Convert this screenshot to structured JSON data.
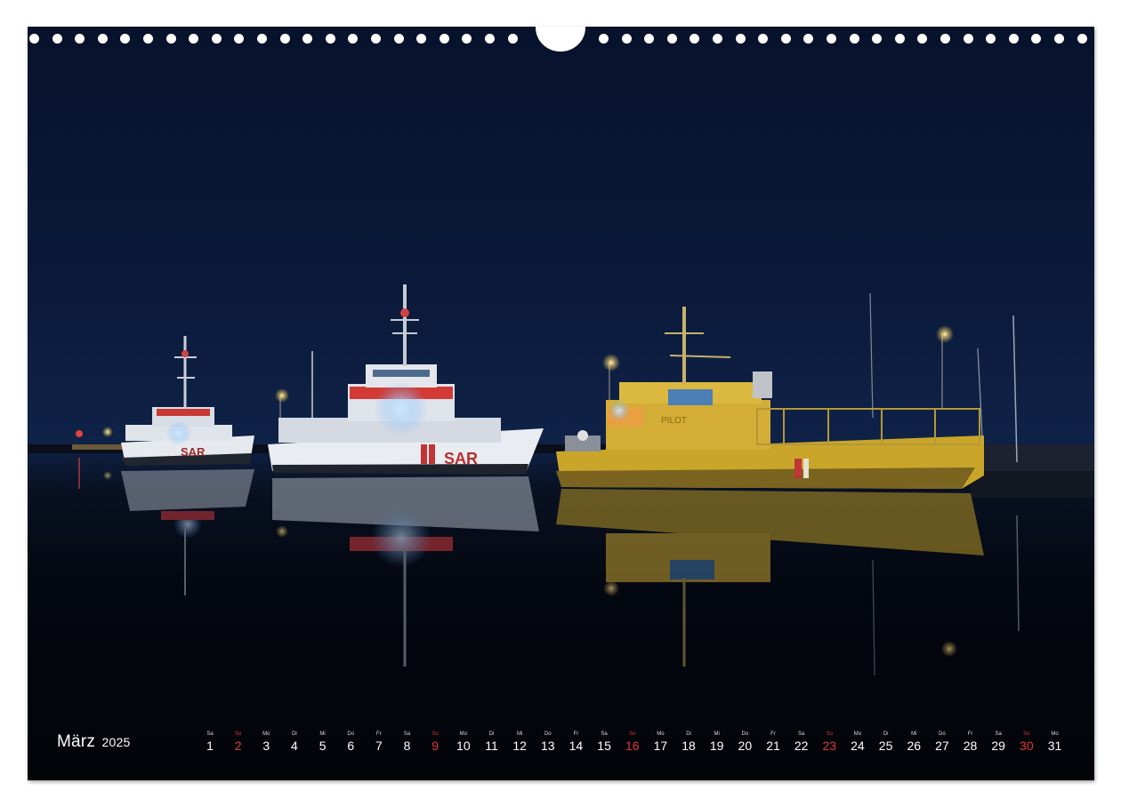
{
  "calendar": {
    "month": "März",
    "year": "2025",
    "days": [
      {
        "weekday": "Sa",
        "day": "1",
        "sunday": false
      },
      {
        "weekday": "So",
        "day": "2",
        "sunday": true
      },
      {
        "weekday": "Mo",
        "day": "3",
        "sunday": false
      },
      {
        "weekday": "Di",
        "day": "4",
        "sunday": false
      },
      {
        "weekday": "Mi",
        "day": "5",
        "sunday": false
      },
      {
        "weekday": "Do",
        "day": "6",
        "sunday": false
      },
      {
        "weekday": "Fr",
        "day": "7",
        "sunday": false
      },
      {
        "weekday": "Sa",
        "day": "8",
        "sunday": false
      },
      {
        "weekday": "So",
        "day": "9",
        "sunday": true
      },
      {
        "weekday": "Mo",
        "day": "10",
        "sunday": false
      },
      {
        "weekday": "Di",
        "day": "11",
        "sunday": false
      },
      {
        "weekday": "Mi",
        "day": "12",
        "sunday": false
      },
      {
        "weekday": "Do",
        "day": "13",
        "sunday": false
      },
      {
        "weekday": "Fr",
        "day": "14",
        "sunday": false
      },
      {
        "weekday": "Sa",
        "day": "15",
        "sunday": false
      },
      {
        "weekday": "So",
        "day": "16",
        "sunday": true
      },
      {
        "weekday": "Mo",
        "day": "17",
        "sunday": false
      },
      {
        "weekday": "Di",
        "day": "18",
        "sunday": false
      },
      {
        "weekday": "Mi",
        "day": "19",
        "sunday": false
      },
      {
        "weekday": "Do",
        "day": "20",
        "sunday": false
      },
      {
        "weekday": "Fr",
        "day": "21",
        "sunday": false
      },
      {
        "weekday": "Sa",
        "day": "22",
        "sunday": false
      },
      {
        "weekday": "So",
        "day": "23",
        "sunday": true
      },
      {
        "weekday": "Mo",
        "day": "24",
        "sunday": false
      },
      {
        "weekday": "Di",
        "day": "25",
        "sunday": false
      },
      {
        "weekday": "Mi",
        "day": "26",
        "sunday": false
      },
      {
        "weekday": "Do",
        "day": "27",
        "sunday": false
      },
      {
        "weekday": "Fr",
        "day": "28",
        "sunday": false
      },
      {
        "weekday": "Sa",
        "day": "29",
        "sunday": false
      },
      {
        "weekday": "So",
        "day": "30",
        "sunday": true
      },
      {
        "weekday": "Mo",
        "day": "31",
        "sunday": false
      }
    ]
  },
  "boats": {
    "left_hull_text": "SAR",
    "middle_hull_text": "SAR",
    "right_cabin_text": "PILOT"
  },
  "colors": {
    "sky": "#0b1a3a",
    "sunday": "#e0383a",
    "pilot_boat": "#c9a62a",
    "sar_red": "#d23a35"
  }
}
